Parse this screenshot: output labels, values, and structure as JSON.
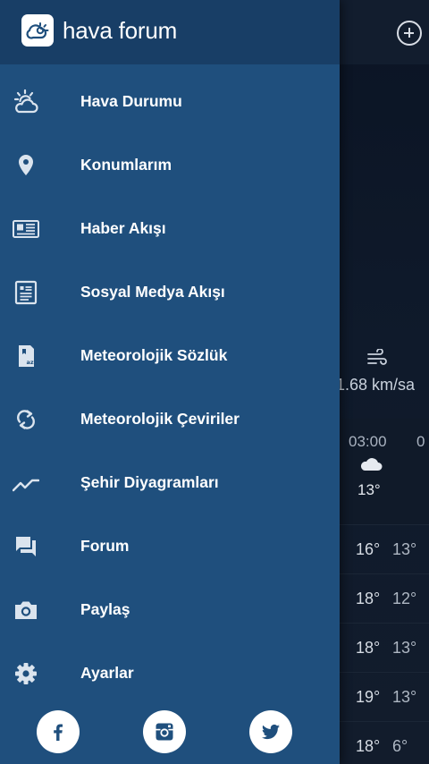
{
  "app": {
    "title": "hava forum"
  },
  "menu": {
    "items": [
      {
        "label": "Hava Durumu",
        "icon": "weather-sun-cloud-icon"
      },
      {
        "label": "Konumlarım",
        "icon": "location-pin-icon"
      },
      {
        "label": "Haber Akışı",
        "icon": "newspaper-icon"
      },
      {
        "label": "Sosyal Medya Akışı",
        "icon": "article-icon"
      },
      {
        "label": "Meteorolojik Sözlük",
        "icon": "dictionary-icon"
      },
      {
        "label": "Meteorolojik Çeviriler",
        "icon": "sync-icon"
      },
      {
        "label": "Şehir Diyagramları",
        "icon": "line-chart-icon"
      },
      {
        "label": "Forum",
        "icon": "forum-icon"
      },
      {
        "label": "Paylaş",
        "icon": "camera-icon"
      },
      {
        "label": "Ayarlar",
        "icon": "gear-icon"
      }
    ]
  },
  "social": {
    "items": [
      {
        "icon": "facebook-icon"
      },
      {
        "icon": "instagram-icon"
      },
      {
        "icon": "twitter-icon"
      }
    ]
  },
  "background": {
    "wind": "1.68 km/sa",
    "hours": [
      "03:00",
      "0"
    ],
    "hour_temp": "13°",
    "daily": [
      {
        "hi": "16°",
        "lo": "13°"
      },
      {
        "hi": "18°",
        "lo": "12°"
      },
      {
        "hi": "18°",
        "lo": "13°"
      },
      {
        "hi": "19°",
        "lo": "13°"
      },
      {
        "hi": "18°",
        "lo": "6°"
      }
    ]
  },
  "colors": {
    "drawer": "#1f4f7d",
    "drawer_header": "#183e66",
    "background": "#0e1828",
    "icon": "#dbe4ee",
    "text": "#ffffff",
    "social_icon": "#1f4f7d"
  }
}
